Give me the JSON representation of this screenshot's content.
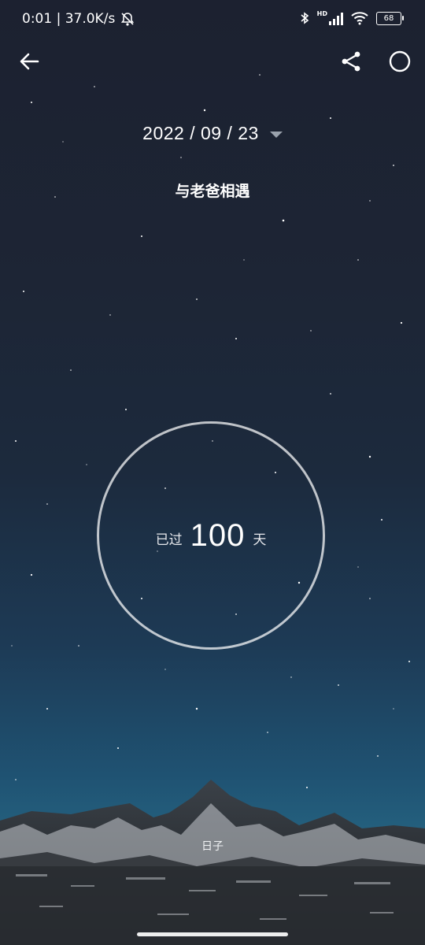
{
  "status_bar": {
    "time_speed": "0:01 | 37.0K/s",
    "network_badge": "HD",
    "battery_level": "68"
  },
  "event": {
    "date": "2022 / 09 / 23",
    "title": "与老爸相遇"
  },
  "counter": {
    "prefix": "已过",
    "value": "100",
    "suffix": "天"
  },
  "footer": {
    "label": "日子"
  },
  "colors": {
    "ring": "#c9ccd1",
    "sky_top": "#1c2130",
    "sky_horizon": "#24607e"
  },
  "icons": {
    "back": "arrow-left-icon",
    "share": "share-icon",
    "mode": "circle-icon"
  }
}
